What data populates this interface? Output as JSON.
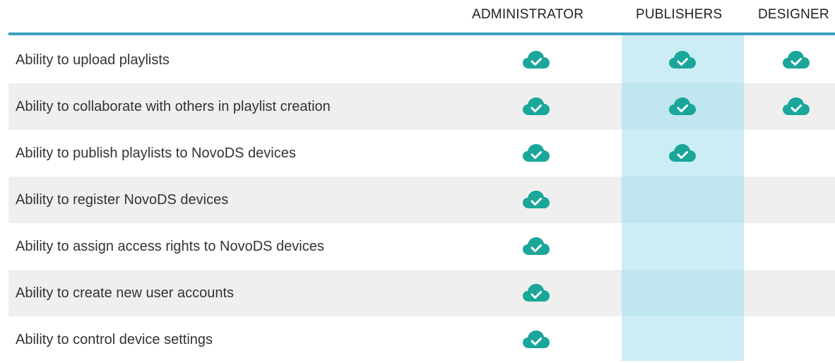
{
  "columns": [
    "ADMINISTRATOR",
    "PUBLISHERS",
    "DESIGNER"
  ],
  "colors": {
    "accent": "#3aa0c0",
    "check": "#1aa79a",
    "highlight_column": "#cdedf4",
    "row_alt": "#efefef"
  },
  "icon": "cloud-check-icon",
  "rows": [
    {
      "label": "Ability to upload playlists",
      "administrator": true,
      "publishers": true,
      "designer": true
    },
    {
      "label": "Ability to collaborate with others in playlist creation",
      "administrator": true,
      "publishers": true,
      "designer": true
    },
    {
      "label": "Ability to publish playlists to NovoDS devices",
      "administrator": true,
      "publishers": true,
      "designer": false
    },
    {
      "label": "Ability to register NovoDS devices",
      "administrator": true,
      "publishers": false,
      "designer": false
    },
    {
      "label": "Ability to assign access rights to NovoDS devices",
      "administrator": true,
      "publishers": false,
      "designer": false
    },
    {
      "label": "Ability to create new user accounts",
      "administrator": true,
      "publishers": false,
      "designer": false
    },
    {
      "label": "Ability to control device settings",
      "administrator": true,
      "publishers": false,
      "designer": false
    }
  ]
}
